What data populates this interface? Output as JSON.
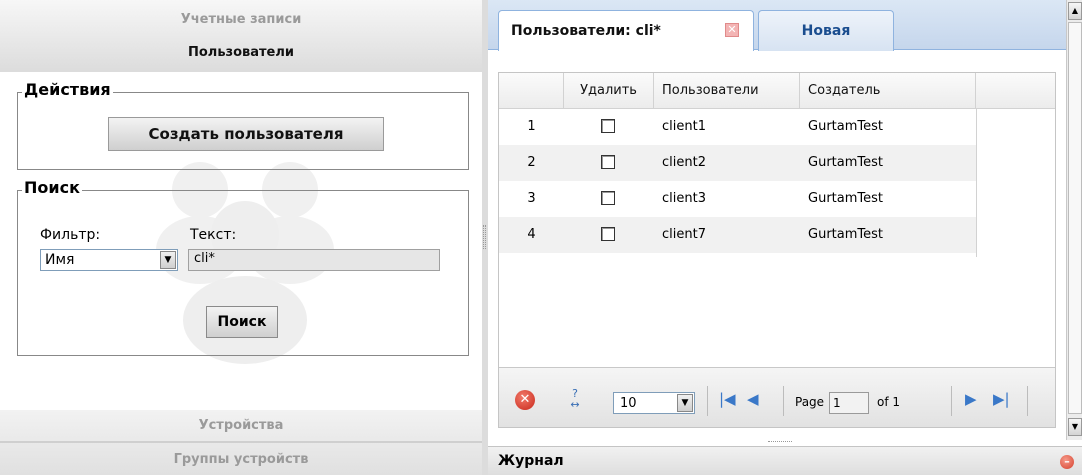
{
  "left_panel": {
    "accordion": [
      {
        "label": "Учетные записи",
        "active": false
      },
      {
        "label": "Пользователи",
        "active": true
      },
      {
        "label": "Устройства",
        "active": false
      },
      {
        "label": "Группы устройств",
        "active": false
      }
    ],
    "actions_group": {
      "legend": "Действия",
      "create_button": "Создать пользователя"
    },
    "search_group": {
      "legend": "Поиск",
      "filter_label": "Фильтр:",
      "filter_value": "Имя",
      "text_label": "Текст:",
      "text_value": "cli*",
      "search_button": "Поиск"
    }
  },
  "tabs": [
    {
      "label": "Пользователи: cli*",
      "active": true,
      "closable": true
    },
    {
      "label": "Новая",
      "active": false
    }
  ],
  "grid": {
    "columns": [
      "Удалить",
      "Пользователи",
      "Создатель"
    ],
    "rows": [
      {
        "num": "1",
        "name": "client1",
        "creator": "GurtamTest",
        "checked": false
      },
      {
        "num": "2",
        "name": "client2",
        "creator": "GurtamTest",
        "checked": false
      },
      {
        "num": "3",
        "name": "client3",
        "creator": "GurtamTest",
        "checked": false
      },
      {
        "num": "4",
        "name": "client7",
        "creator": "GurtamTest",
        "checked": false
      }
    ]
  },
  "pager": {
    "page_size": "10",
    "page_label": "Page",
    "current_page": "1",
    "of_label": "of 1",
    "icons": [
      "delete-icon",
      "help-icon",
      "first-page-icon",
      "prev-page-icon",
      "next-page-icon",
      "last-page-icon"
    ]
  },
  "journal": {
    "label": "Журнал"
  },
  "colors": {
    "tab_accent": "#1a4d8f",
    "delete_red": "#c8271a",
    "nav_blue": "#3a78c8"
  }
}
